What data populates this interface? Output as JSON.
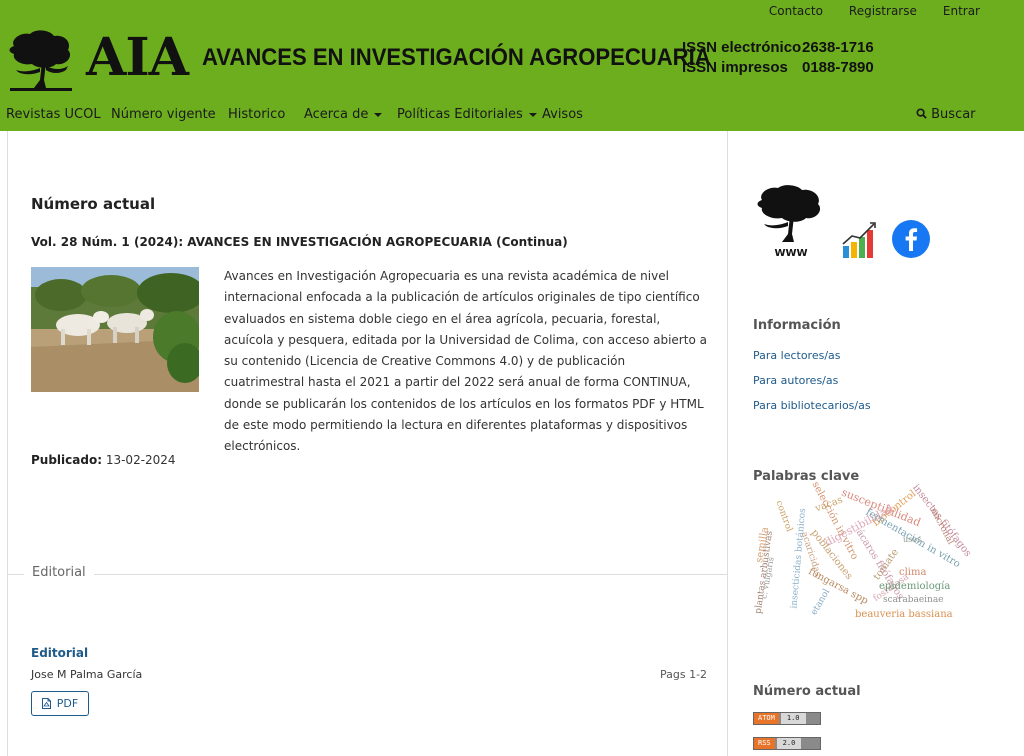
{
  "top_links": {
    "contact": "Contacto",
    "register": "Registrarse",
    "login": "Entrar"
  },
  "logo": {
    "acronym": "AIA",
    "title": "AVANCES EN INVESTIGACIÓN AGROPECUARIA"
  },
  "issn": {
    "electronic_label": "ISSN electrónico",
    "electronic_value": "2638-1716",
    "print_label": "ISSN impresos",
    "print_value": "0188-7890"
  },
  "nav": {
    "journals": "Revistas UCOL",
    "current": "Número vigente",
    "history": "Historico",
    "about": "Acerca de",
    "policies": "Políticas Editoriales",
    "notices": "Avisos",
    "search": "Buscar"
  },
  "main": {
    "heading": "Número actual",
    "issue_title": "Vol. 28 Núm. 1 (2024): AVANCES EN INVESTIGACIÓN AGROPECUARIA (Continua)",
    "description": "Avances en Investigación Agropecuaria es una revista académica de nivel internacional enfocada a la publicación de artículos originales de tipo científico evaluados en sistema doble ciego en el área agrícola, pecuaria, forestal, acuícola y pesquera, editada por la Universidad de Colima, con acceso abierto a su contenido (Licencia de Creative Commons 4.0) y de publicación cuatrimestral hasta el 2021 a partir del 2022 será anual de forma CONTINUA, donde se publicarán los contenidos de los artículos en los formatos PDF y HTML de este modo permitiendo la lectura en diferentes plataformas y dispositivos electrónicos.",
    "published_label": "Publicado:",
    "published_date": "13-02-2024",
    "section": "Editorial",
    "article": {
      "title": "Editorial",
      "author": "Jose M Palma García",
      "pages": "Pags 1-2",
      "pdf": "PDF"
    }
  },
  "sidebar": {
    "www_label": "WWW",
    "info_heading": "Información",
    "info_links": [
      "Para lectores/as",
      "Para autores/as",
      "Para bibliotecarios/as"
    ],
    "keywords_heading": "Palabras clave",
    "keywords": [
      "vacas",
      "susceptibilidad",
      "biocontrol",
      "insectos fitófagos",
      "micronal",
      "semilla",
      "control",
      "selección in vitro",
      "digestibilidad",
      "fermentación in vitro",
      "usos",
      "plantas arbustivas",
      "c. vulgaris",
      "insecticidas botánicos",
      "poblaciones",
      "tomate",
      "clima",
      "acaricidas",
      "ácaros fitófagos",
      "fosfatasa",
      "epidemiología",
      "fungarsa spp",
      "etanol",
      "scarabaeinae",
      "beauveria bassiana"
    ],
    "current_heading": "Número actual",
    "feeds": [
      {
        "name": "ATOM",
        "version": "1.0"
      },
      {
        "name": "RSS",
        "version": "2.0"
      }
    ]
  },
  "colors": {
    "header_green": "#6dae1f",
    "link_blue": "#1e5a8a"
  }
}
